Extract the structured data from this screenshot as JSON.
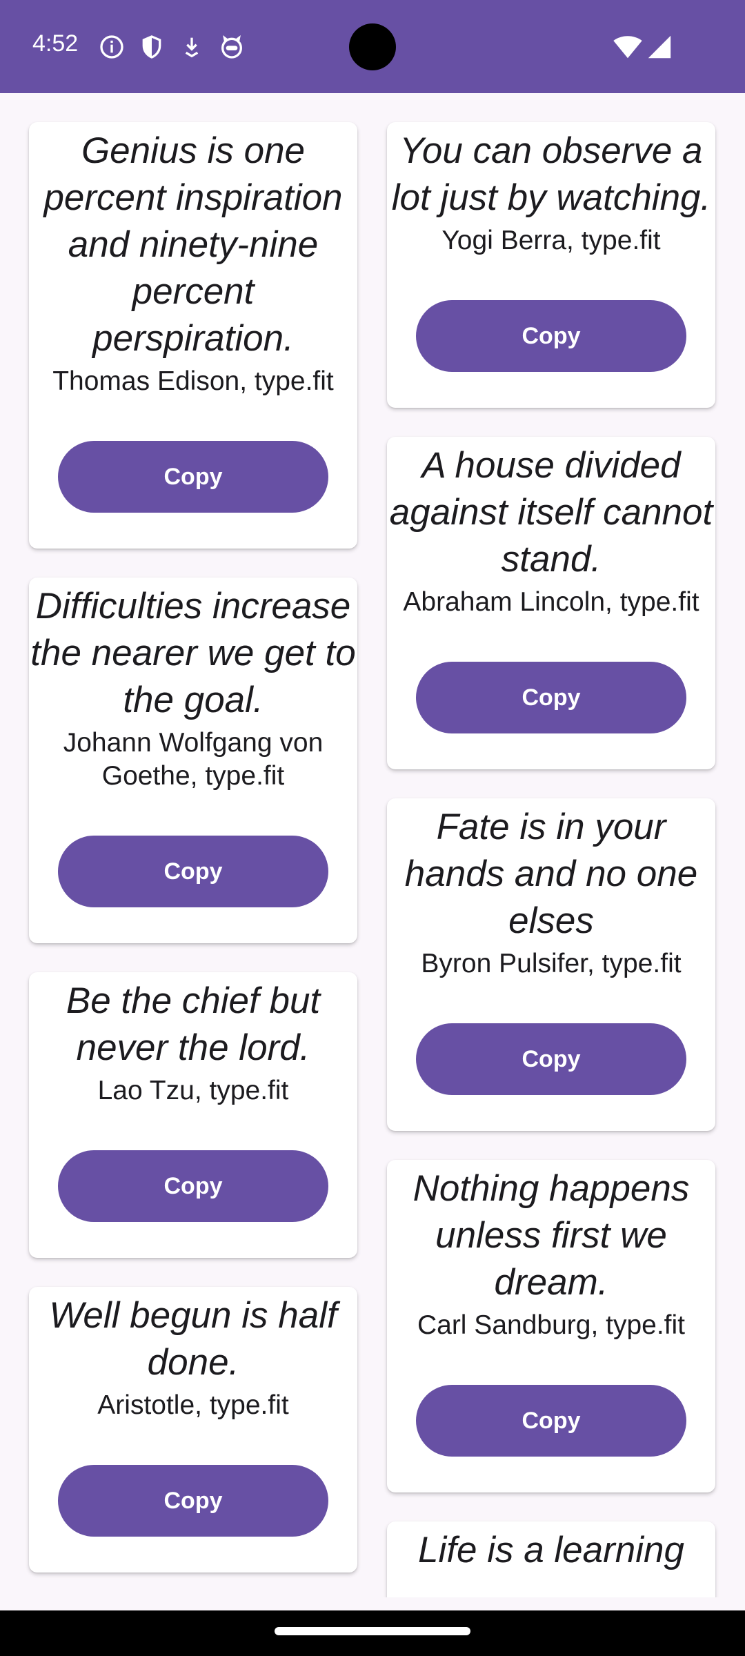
{
  "status_bar": {
    "time": "4:52",
    "icons": [
      "info-icon",
      "shield-icon",
      "download-arrow-icon",
      "cat-face-icon"
    ],
    "right_icons": [
      "wifi-icon",
      "signal-icon"
    ],
    "background_color": "#6750A4"
  },
  "left_column": [
    {
      "quote": "Genius is one percent inspiration and ninety-nine percent perspiration.",
      "author": "Thomas Edison, type.fit",
      "button": "Copy"
    },
    {
      "quote": "Difficulties increase the nearer we get to the goal.",
      "author": "Johann Wolfgang von Goethe, type.fit",
      "button": "Copy"
    },
    {
      "quote": "Be the chief but never the lord.",
      "author": "Lao Tzu, type.fit",
      "button": "Copy"
    },
    {
      "quote": "Well begun is half done.",
      "author": "Aristotle, type.fit",
      "button": "Copy"
    }
  ],
  "right_column": [
    {
      "quote": "You can observe a lot just by watching.",
      "author": "Yogi Berra, type.fit",
      "button": "Copy"
    },
    {
      "quote": "A house divided against itself cannot stand.",
      "author": "Abraham Lincoln, type.fit",
      "button": "Copy"
    },
    {
      "quote": "Fate is in your hands and no one elses",
      "author": "Byron Pulsifer, type.fit",
      "button": "Copy"
    },
    {
      "quote": "Nothing happens unless first we dream.",
      "author": "Carl Sandburg, type.fit",
      "button": "Copy"
    },
    {
      "quote": "Life is a learning",
      "author": "",
      "button": ""
    }
  ],
  "colors": {
    "accent": "#6750A4",
    "background": "#FAF6FB",
    "card": "#FFFFFF"
  }
}
